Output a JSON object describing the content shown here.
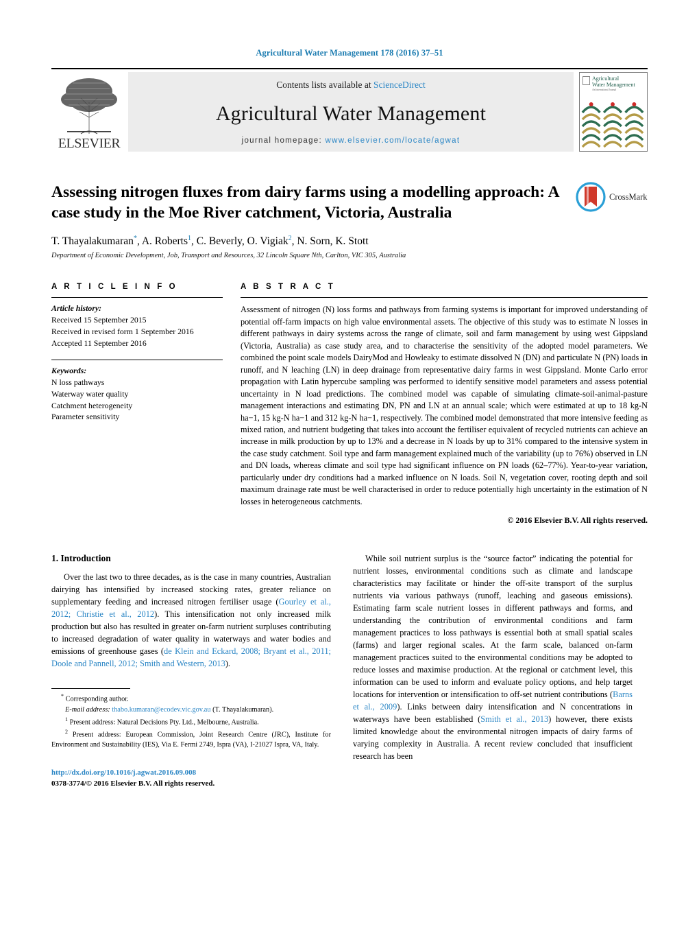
{
  "running_head": "Agricultural Water Management 178 (2016) 37–51",
  "masthead": {
    "publisher_logo_text": "ELSEVIER",
    "contents_prefix": "Contents lists available at",
    "contents_link": "ScienceDirect",
    "journal_name": "Agricultural Water Management",
    "homepage_prefix": "journal homepage:",
    "homepage_link": "www.elsevier.com/locate/agwat",
    "cover_title_line1": "Agricultural",
    "cover_title_line2": "Water Management",
    "cover_sub": "An International Journal"
  },
  "article": {
    "title": "Assessing nitrogen fluxes from dairy farms using a modelling approach: A case study in the Moe River catchment, Victoria, Australia",
    "crossmark_label": "CrossMark",
    "authors_html": "T. Thayalakumaran*, A. Roberts1, C. Beverly, O. Vigiak2, N. Sorn, K. Stott",
    "affiliation": "Department of Economic Development, Job, Transport and Resources, 32 Lincoln Square Nth, Carlton, VIC 305, Australia"
  },
  "article_info": {
    "heading": "A R T I C L E   I N F O",
    "history_label": "Article history:",
    "history": [
      "Received 15 September 2015",
      "Received in revised form 1 September 2016",
      "Accepted 11 September 2016"
    ],
    "keywords_label": "Keywords:",
    "keywords": [
      "N loss pathways",
      "Waterway water quality",
      "Catchment heterogeneity",
      "Parameter sensitivity"
    ]
  },
  "abstract": {
    "heading": "A B S T R A C T",
    "text": "Assessment of nitrogen (N) loss forms and pathways from farming systems is important for improved understanding of potential off-farm impacts on high value environmental assets. The objective of this study was to estimate N losses in different pathways in dairy systems across the range of climate, soil and farm management by using west Gippsland (Victoria, Australia) as case study area, and to characterise the sensitivity of the adopted model parameters. We combined the point scale models DairyMod and Howleaky to estimate dissolved N (DN) and particulate N (PN) loads in runoff, and N leaching (LN) in deep drainage from representative dairy farms in west Gippsland. Monte Carlo error propagation with Latin hypercube sampling was performed to identify sensitive model parameters and assess potential uncertainty in N load predictions. The combined model was capable of simulating climate-soil-animal-pasture management interactions and estimating DN, PN and LN at an annual scale; which were estimated at up to 18 kg-N ha−1, 15 kg-N ha−1 and 312 kg-N ha−1, respectively. The combined model demonstrated that more intensive feeding as mixed ration, and nutrient budgeting that takes into account the fertiliser equivalent of recycled nutrients can achieve an increase in milk production by up to 13% and a decrease in N loads by up to 31% compared to the intensive system in the case study catchment. Soil type and farm management explained much of the variability (up to 76%) observed in LN and DN loads, whereas climate and soil type had significant influence on PN loads (62–77%). Year-to-year variation, particularly under dry conditions had a marked influence on N loads. Soil N, vegetation cover, rooting depth and soil maximum drainage rate must be well characterised in order to reduce potentially high uncertainty in the estimation of N losses in heterogeneous catchments.",
    "copyright": "© 2016 Elsevier B.V. All rights reserved."
  },
  "introduction": {
    "heading": "1.  Introduction",
    "left_paragraph_parts": [
      "Over the last two to three decades, as is the case in many countries, Australian dairying has intensified by increased stocking rates, greater reliance on supplementary feeding and increased nitrogen fertiliser usage (",
      "Gourley et al., 2012; Christie et al., 2012",
      "). This intensification not only increased milk production but also has resulted in greater on-farm nutrient surpluses contributing to increased degradation of water quality in waterways and water bodies and emissions of greenhouse gases (",
      "de Klein and Eckard, 2008; Bryant et al., 2011; Doole and Pannell, 2012; Smith and Western, 2013",
      ")."
    ],
    "right_paragraph_parts": [
      "While soil nutrient surplus is the “source factor” indicating the potential for nutrient losses, environmental conditions such as climate and landscape characteristics may facilitate or hinder the off-site transport of the surplus nutrients via various pathways (runoff, leaching and gaseous emissions). Estimating farm scale nutrient losses in different pathways and forms, and understanding the contribution of environmental conditions and farm management practices to loss pathways is essential both at small spatial scales (farms) and larger regional scales. At the farm scale, balanced on-farm management practices suited to the environmental conditions may be adopted to reduce losses and maximise production. At the regional or catchment level, this information can be used to inform and evaluate policy options, and help target locations for intervention or intensification to off-set nutrient contributions (",
      "Barns et al., 2009",
      "). Links between dairy intensification and N concentrations in waterways have been established (",
      "Smith et al., 2013",
      ") however, there exists limited knowledge about the environmental nitrogen impacts of dairy farms of varying complexity in Australia. A recent review concluded that insufficient research has been"
    ]
  },
  "footnotes": {
    "corresponding_marker": "*",
    "corresponding_text": "Corresponding author.",
    "email_label": "E-mail address:",
    "email": "thabo.kumaran@ecodev.vic.gov.au",
    "email_attrib": "(T. Thayalakumaran).",
    "note1_marker": "1",
    "note1": "Present address: Natural Decisions Pty. Ltd., Melbourne, Australia.",
    "note2_marker": "2",
    "note2": "Present address: European Commission, Joint Research Centre (JRC), Institute for Environment and Sustainability (IES), Via E. Fermi 2749, Ispra (VA), I-21027 Ispra, VA, Italy."
  },
  "publication": {
    "doi_url": "http://dx.doi.org/10.1016/j.agwat.2016.09.008",
    "issn_line": "0378-3774/© 2016 Elsevier B.V. All rights reserved."
  },
  "colors": {
    "link": "#2b86c5",
    "runhead": "#1a7bb0",
    "banner_bg": "#ececec",
    "elsevier_orange": "#ef7c22",
    "cover_green": "#2d6e52",
    "cover_gold": "#b49b47",
    "crossmark_blue": "#2a9fd6",
    "crossmark_red": "#d0392b"
  }
}
